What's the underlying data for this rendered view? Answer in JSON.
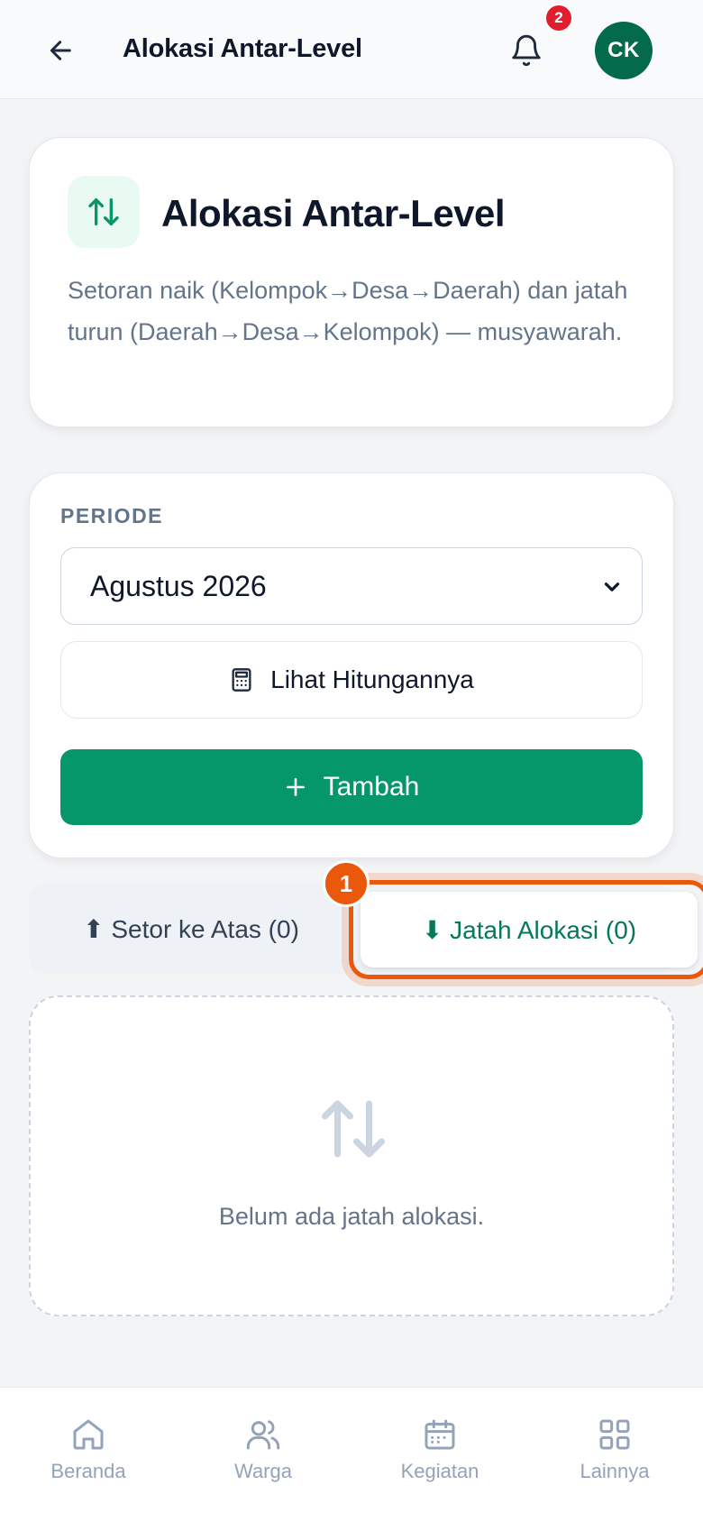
{
  "header": {
    "title": "Alokasi Antar-Level",
    "notification_count": "2",
    "avatar_initials": "CK"
  },
  "intro": {
    "title": "Alokasi Antar-Level",
    "description": "Setoran naik (Kelompok→Desa→Daerah) dan jatah turun (Daerah→Desa→Kelompok) — musyawarah."
  },
  "period": {
    "label": "PERIODE",
    "selected": "Agustus 2026",
    "calc_button": "Lihat Hitungannya",
    "add_button": "Tambah"
  },
  "tabs": {
    "up_label": "⬆ Setor ke Atas (0)",
    "down_label": "⬇ Jatah Alokasi (0)",
    "active": "down"
  },
  "step_badge": "1",
  "empty_state": {
    "text": "Belum ada jatah alokasi."
  },
  "bottom_nav": {
    "items": [
      {
        "label": "Beranda",
        "icon": "home-icon"
      },
      {
        "label": "Warga",
        "icon": "users-icon"
      },
      {
        "label": "Kegiatan",
        "icon": "calendar-icon"
      },
      {
        "label": "Lainnya",
        "icon": "grid-icon"
      }
    ]
  },
  "colors": {
    "primary": "#059669",
    "highlight": "#ea580c",
    "badge": "#e11d2e",
    "avatar": "#046b4a"
  }
}
